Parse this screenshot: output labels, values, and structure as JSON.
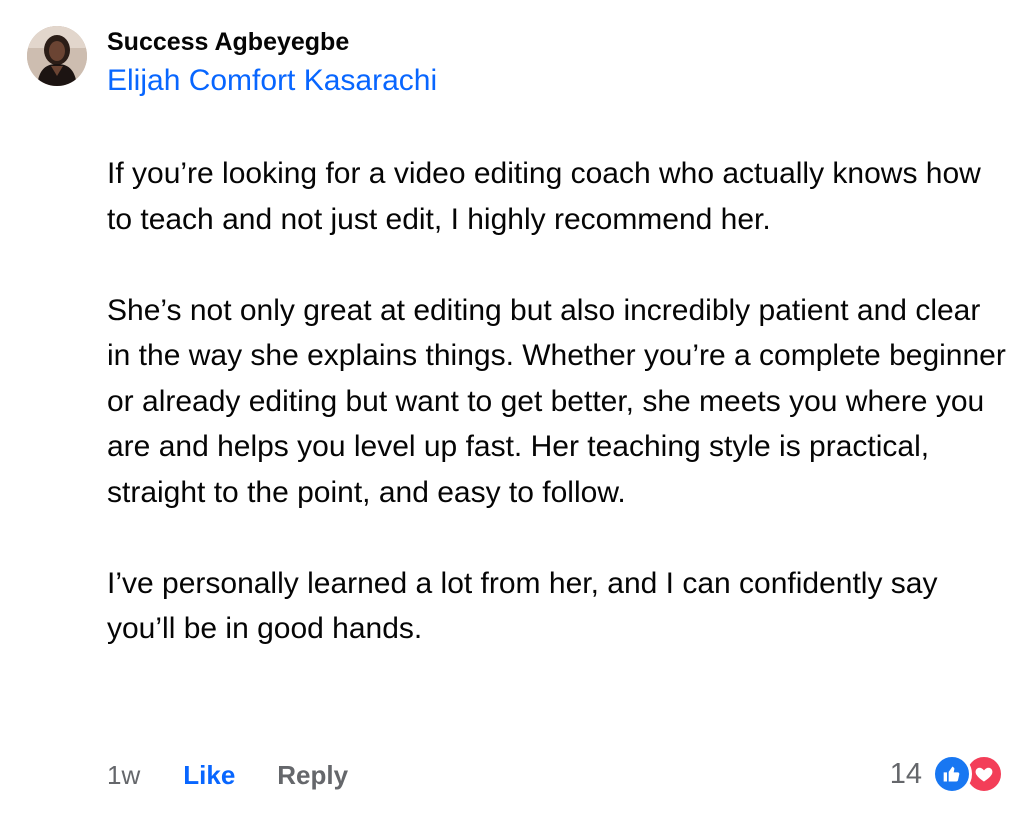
{
  "comment": {
    "author": "Success Agbeyegbe",
    "mention": "Elijah Comfort Kasarachi",
    "paragraphs": [
      "If you’re looking for a video editing coach who actually knows how to teach and not just edit, I highly recommend her.",
      "She’s not only great at editing but also incredibly patient and clear in the way she explains things. Whether you’re a complete beginner or already editing but want to get better, she meets you where you are and helps you level up fast. Her teaching style is practical, straight to the point, and easy to follow.",
      "I’ve personally learned a lot from her, and I can confidently say you’ll be in good hands."
    ],
    "timestamp": "1w",
    "like_label": "Like",
    "reply_label": "Reply",
    "reaction_count": "14",
    "reaction_icons": [
      "like-icon",
      "love-icon"
    ]
  },
  "colors": {
    "link_blue": "#0866ff",
    "like_blue": "#1877f2",
    "love_red": "#f33e58",
    "secondary_text": "#65676b",
    "primary_text": "#050505"
  }
}
